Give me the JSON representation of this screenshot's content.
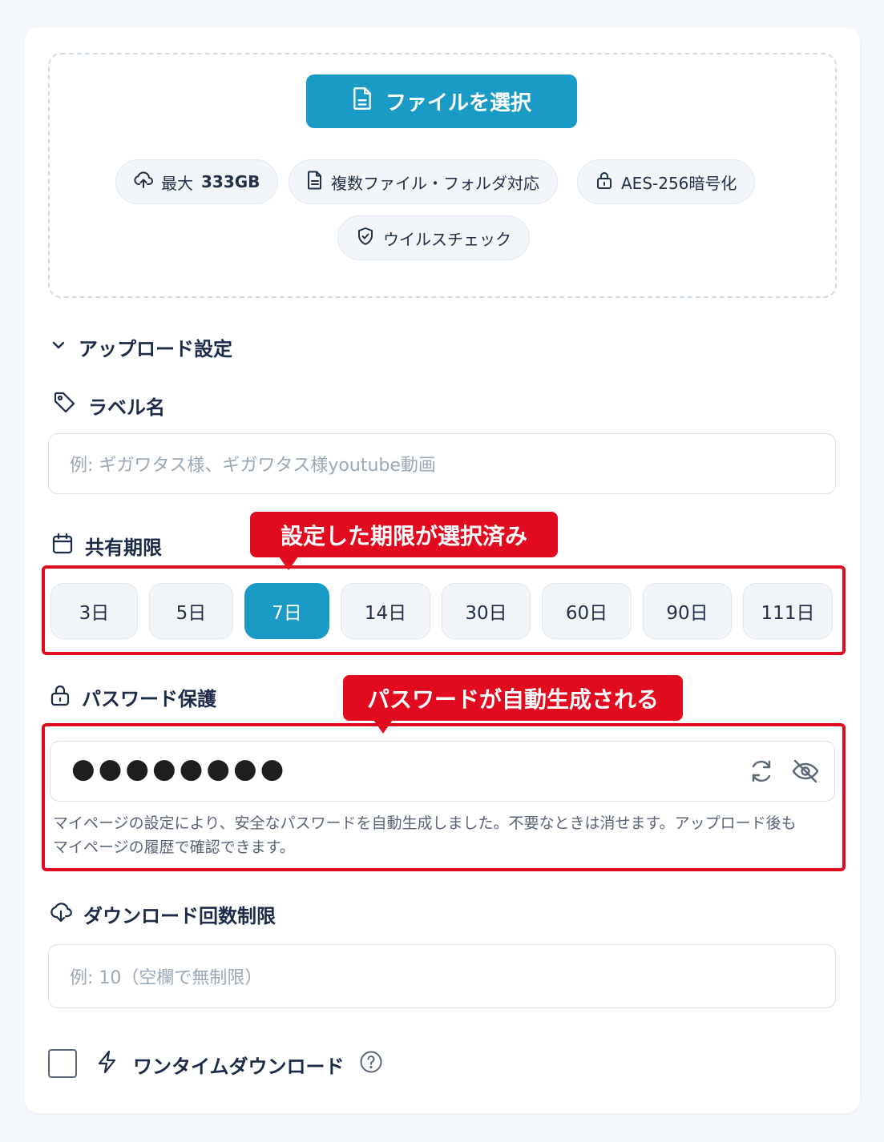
{
  "upload": {
    "select_button": "ファイルを選択",
    "chips": {
      "max_size_label": "最大",
      "max_size_value": "333GB",
      "multi_file": "複数ファイル・フォルダ対応",
      "encryption": "AES-256暗号化",
      "virus_check": "ウイルスチェック"
    }
  },
  "settings": {
    "toggle_label": "アップロード設定",
    "label_name": {
      "title": "ラベル名",
      "placeholder": "例: ギガワタス様、ギガワタス様youtube動画"
    },
    "share_term": {
      "title": "共有期限",
      "options": [
        "3日",
        "5日",
        "7日",
        "14日",
        "30日",
        "60日",
        "90日",
        "111日"
      ],
      "selected": "7日"
    },
    "password": {
      "title": "パスワード保護",
      "value": "●●●●●●●●",
      "help_line1": "マイページの設定により、安全なパスワードを自動生成しました。不要なときは消せます。アップロード後も",
      "help_line2": "マイページの履歴で確認できます。"
    },
    "download_limit": {
      "title": "ダウンロード回数制限",
      "placeholder": "例: 10（空欄で無制限）"
    },
    "one_time": {
      "label": "ワンタイムダウンロード",
      "checked": false
    }
  },
  "annotations": {
    "term_callout": "設定した期限が選択済み",
    "password_callout": "パスワードが自動生成される"
  },
  "colors": {
    "accent": "#1a9bc6",
    "annotation_red": "#e10a1e"
  }
}
